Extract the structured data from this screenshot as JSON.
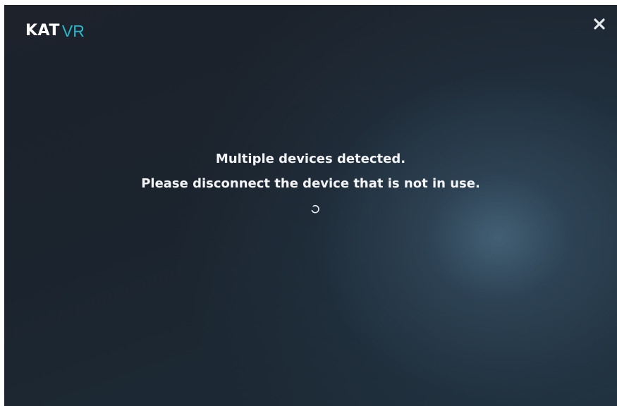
{
  "header": {
    "logo_primary": "KAT",
    "logo_secondary": "VR",
    "close_icon": "close-icon"
  },
  "dialog": {
    "message_line1": "Multiple devices detected.",
    "message_line2": "Please disconnect the device that is not in use.",
    "spinner_icon": "loading-spinner-icon"
  },
  "colors": {
    "background": "#1c2530",
    "text": "#f2f4f6",
    "logo_accent": "#2cb6c9",
    "close": "#e6e9ec"
  }
}
